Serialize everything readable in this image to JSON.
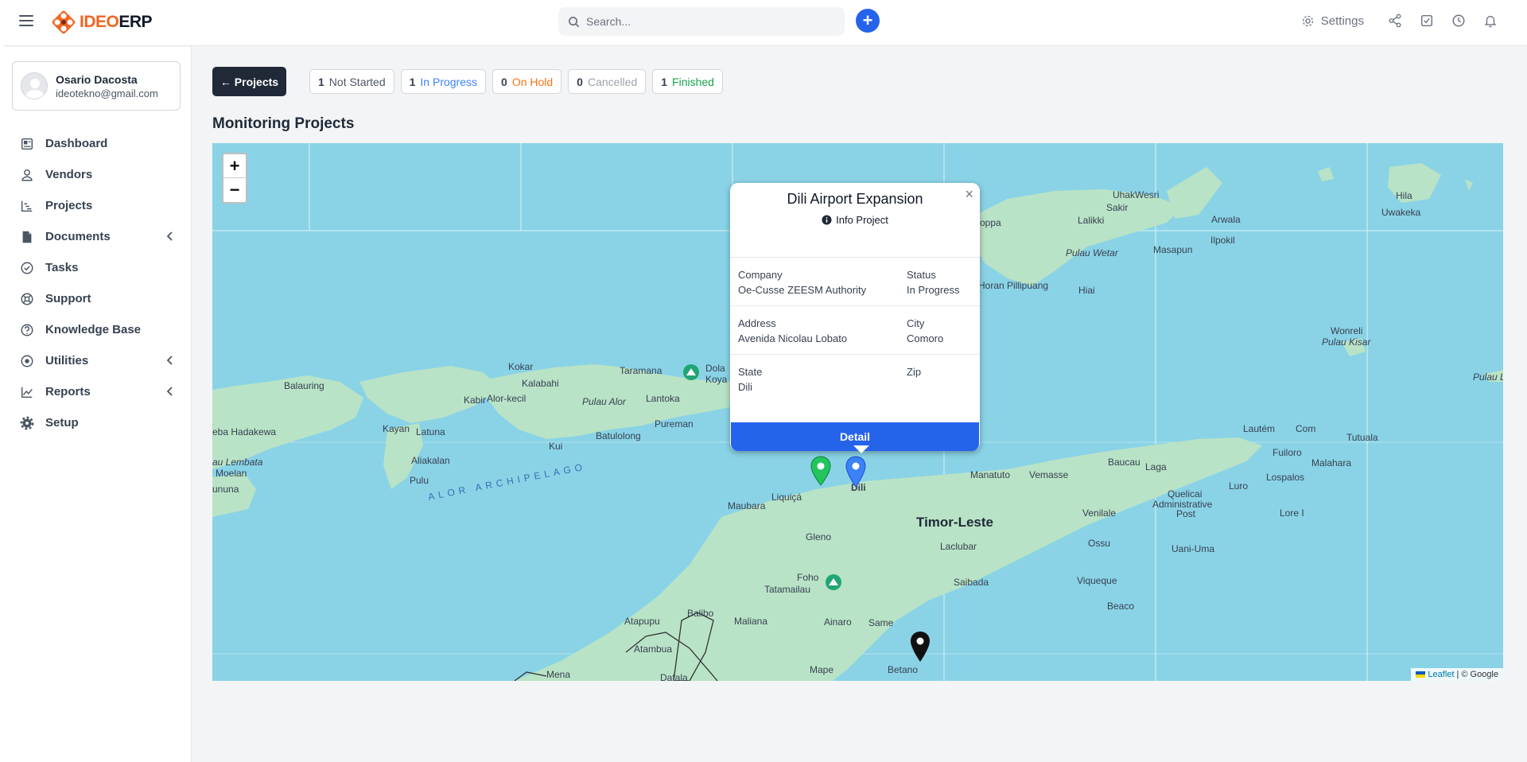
{
  "topbar": {
    "brand": "IDEO",
    "brand_suffix": "ERP",
    "search_placeholder": "Search...",
    "settings_label": "Settings",
    "icons": [
      "menu-icon",
      "search-icon",
      "plus-icon",
      "gear-icon",
      "share-icon",
      "checkbox-icon",
      "clock-icon",
      "bell-icon"
    ]
  },
  "user": {
    "name": "Osario Dacosta",
    "email": "ideotekno@gmail.com"
  },
  "sidebar": {
    "items": [
      {
        "label": "Dashboard",
        "icon": "dashboard-icon"
      },
      {
        "label": "Vendors",
        "icon": "user-icon"
      },
      {
        "label": "Projects",
        "icon": "chart-icon"
      },
      {
        "label": "Documents",
        "icon": "document-icon",
        "expandable": true
      },
      {
        "label": "Tasks",
        "icon": "check-circle-icon"
      },
      {
        "label": "Support",
        "icon": "lifebuoy-icon"
      },
      {
        "label": "Knowledge Base",
        "icon": "question-icon"
      },
      {
        "label": "Utilities",
        "icon": "radio-icon",
        "expandable": true
      },
      {
        "label": "Reports",
        "icon": "line-chart-icon",
        "expandable": true
      },
      {
        "label": "Setup",
        "icon": "cog-icon"
      }
    ]
  },
  "header": {
    "back_label": "← Projects",
    "title": "Monitoring Projects"
  },
  "statuses": [
    {
      "count": "1",
      "label": "Not Started",
      "color": "#4b5563"
    },
    {
      "count": "1",
      "label": "In Progress",
      "color": "#3b82f6"
    },
    {
      "count": "0",
      "label": "On Hold",
      "color": "#f97316"
    },
    {
      "count": "0",
      "label": "Cancelled",
      "color": "#9ca3af"
    },
    {
      "count": "1",
      "label": "Finished",
      "color": "#16a34a"
    }
  ],
  "map": {
    "zoom_in": "+",
    "zoom_out": "−",
    "attribution_link": "Leaflet",
    "attribution_text": "| © Google",
    "labels": {
      "balauring": "Balauring",
      "kokar": "Kokar",
      "kalabahi": "Kalabahi",
      "taramana": "Taramana",
      "dola": "Dola",
      "koya": "Koya",
      "kabir": "Kabir",
      "alorkecil": "Alor-kecil",
      "pulaualor": "Pulau Alor",
      "lantoka": "Lantoka",
      "pureman": "Pureman",
      "batulolong": "Batulolong",
      "kayan": "Kayan",
      "latuna": "Latuna",
      "hadakewa": "eba Hadakewa",
      "kui": "Kui",
      "aliakalan": "Aliakalan",
      "lembata": "au Lembata",
      "moelan": "Moelan",
      "pulu": "Pulu",
      "ununa": "ununa",
      "archipelago": "ALOR ARCHIPELAGO",
      "uhak": "Uhak",
      "wesri": "Wesri",
      "sakir": "Sakir",
      "lalikki": "Lalikki",
      "arwala": "Arwala",
      "ilpokil": "Ilpokil",
      "masapun": "Masapun",
      "pulauwetar": "Pulau Wetar",
      "hiai": "Hiai",
      "pillipuang": "Horan Pillipuang",
      "oppa": "oppa",
      "hila": "Hila",
      "uwakeka": "Uwakeka",
      "wonreli": "Wonreli",
      "pulaukisar": "Pulau Kisar",
      "pulaul": "Pulau L",
      "lautem": "Lautém",
      "com": "Com",
      "tutuala": "Tutuala",
      "fuiloro": "Fuiloro",
      "malahara": "Malahara",
      "baucau": "Baucau",
      "laga": "Laga",
      "manatuto": "Manatuto",
      "vemasse": "Vemasse",
      "luro": "Luro",
      "lospalos": "Lospalos",
      "quelicai": "Quelicai",
      "adminpost": "Administrative",
      "post": "Post",
      "venilale": "Venilale",
      "lorei": "Lore I",
      "timorleste": "Timor-Leste",
      "dili": "Dili",
      "liquica": "Liquiçá",
      "maubara": "Maubara",
      "gleno": "Gleno",
      "laclubar": "Laclubar",
      "ossu": "Ossu",
      "uaniuma": "Uani-Uma",
      "foho": "Foho",
      "tatamailau": "Tatamailau",
      "saibada": "Saibada",
      "viqueque": "Viqueque",
      "beaco": "Beaco",
      "atapupu": "Atapupu",
      "balibo": "Balibo",
      "maliana": "Maliana",
      "ainaro": "Ainaro",
      "same": "Same",
      "atambua": "Atambua",
      "mena": "Mena",
      "dafala": "Dafala",
      "mape": "Mape",
      "betano": "Betano"
    }
  },
  "popup": {
    "title": "Dili Airport Expansion",
    "info_label": "Info Project",
    "company_label": "Company",
    "company_value": "Oe-Cusse ZEESM Authority",
    "status_label": "Status",
    "status_value": "In Progress",
    "address_label": "Address",
    "address_value": "Avenida Nicolau Lobato",
    "city_label": "City",
    "city_value": "Comoro",
    "state_label": "State",
    "state_value": "Dili",
    "zip_label": "Zip",
    "zip_value": "",
    "detail_label": "Detail",
    "close_label": "×"
  }
}
